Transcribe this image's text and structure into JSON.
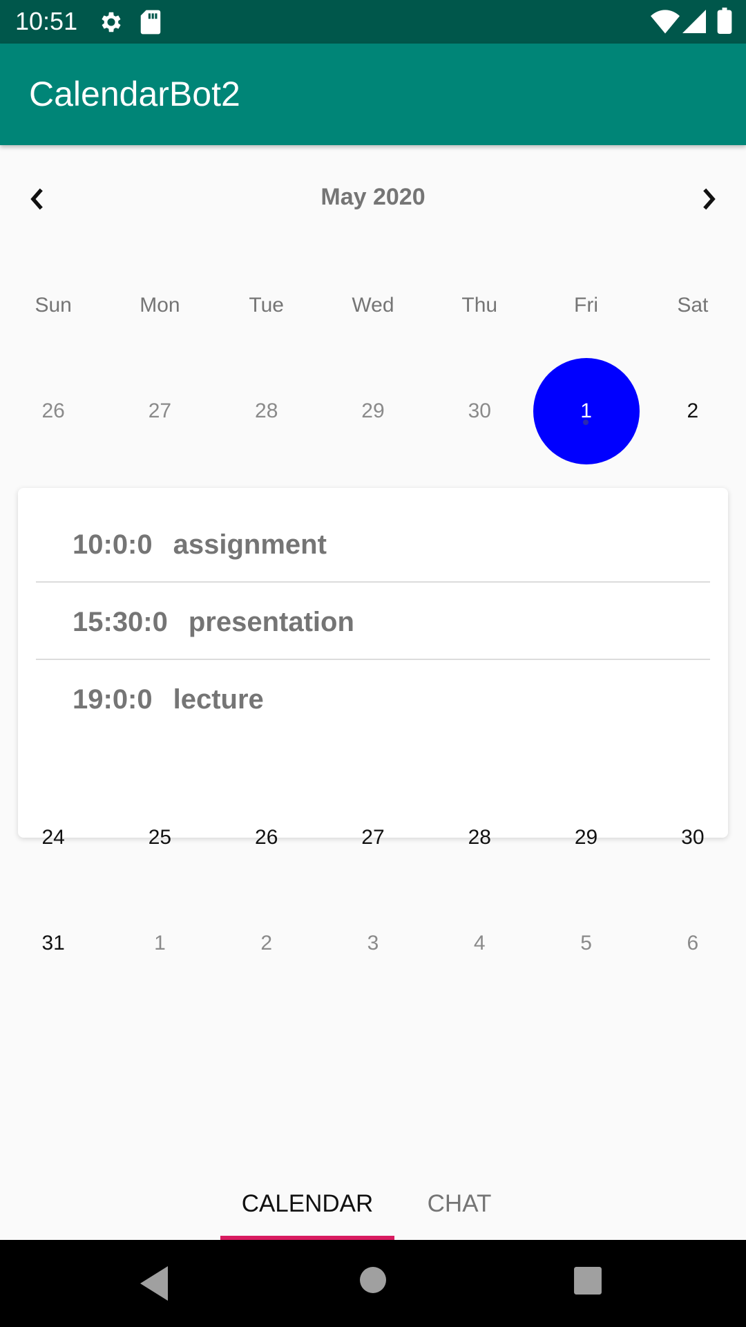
{
  "status_bar": {
    "time": "10:51"
  },
  "app": {
    "title": "CalendarBot2"
  },
  "calendar": {
    "month_title": "May 2020",
    "weekdays": [
      "Sun",
      "Mon",
      "Tue",
      "Wed",
      "Thu",
      "Fri",
      "Sat"
    ],
    "week1": [
      "26",
      "27",
      "28",
      "29",
      "30",
      "1",
      "2"
    ],
    "week_partial": [
      "24",
      "25",
      "26",
      "27",
      "28",
      "29",
      "30"
    ],
    "week6": [
      "31",
      "1",
      "2",
      "3",
      "4",
      "5",
      "6"
    ],
    "selected_day": "1",
    "selected_color": "#0000ff"
  },
  "events": [
    {
      "time": "10:0:0",
      "title": "assignment"
    },
    {
      "time": "15:30:0",
      "title": "presentation"
    },
    {
      "time": "19:0:0",
      "title": "lecture"
    }
  ],
  "tabs": {
    "calendar": "CALENDAR",
    "chat": "CHAT",
    "active": "calendar",
    "indicator_color": "#d81b60"
  },
  "colors": {
    "status_bar": "#00574b",
    "app_bar": "#008577"
  }
}
